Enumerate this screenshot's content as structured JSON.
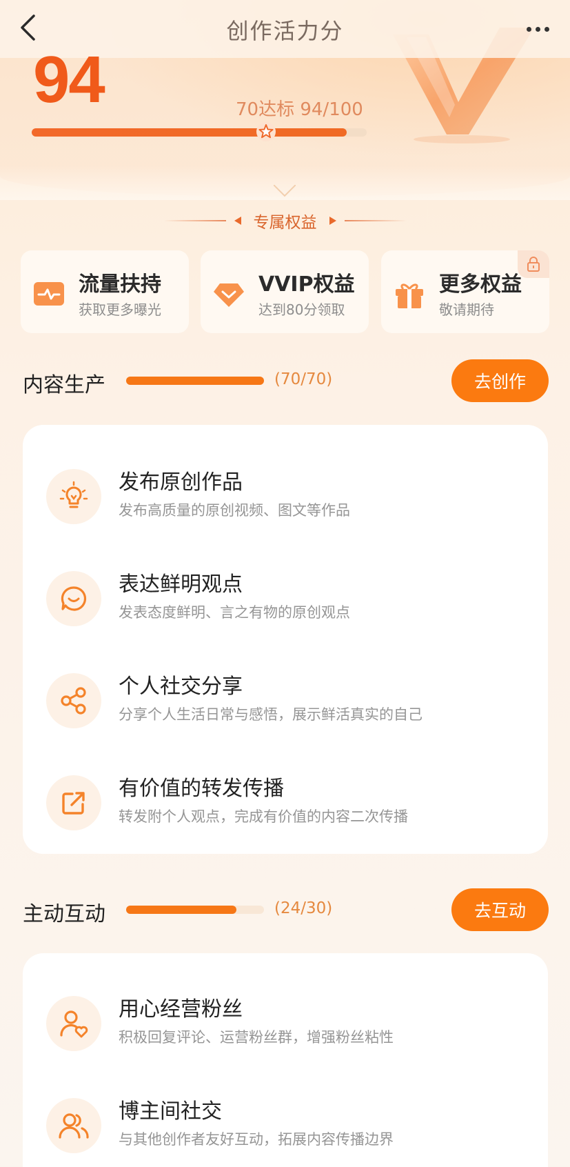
{
  "header": {
    "title": "创作活力分",
    "score": "94",
    "threshold_text": "70达标 94/100",
    "progress_fraction": 0.94,
    "marker_fraction": 0.7
  },
  "rights": {
    "heading": "专属权益",
    "items": [
      {
        "icon": "traffic-support-icon",
        "title": "流量扶持",
        "subtitle": "获取更多曝光"
      },
      {
        "icon": "diamond-icon",
        "title": "VVIP权益",
        "subtitle": "达到80分领取"
      },
      {
        "icon": "gift-icon",
        "title": "更多权益",
        "subtitle": "敬请期待",
        "locked": true
      }
    ]
  },
  "sections": [
    {
      "title": "内容生产",
      "count_text": "(70/70)",
      "progress_fraction": 1.0,
      "button_label": "去创作",
      "tasks": [
        {
          "icon": "lightbulb-icon",
          "title": "发布原创作品",
          "desc": "发布高质量的原创视频、图文等作品"
        },
        {
          "icon": "chat-bubble-icon",
          "title": "表达鲜明观点",
          "desc": "发表态度鲜明、言之有物的原创观点"
        },
        {
          "icon": "share-icon",
          "title": "个人社交分享",
          "desc": "分享个人生活日常与感悟，展示鲜活真实的自己"
        },
        {
          "icon": "forward-icon",
          "title": "有价值的转发传播",
          "desc": "转发附个人观点，完成有价值的内容二次传播"
        }
      ]
    },
    {
      "title": "主动互动",
      "count_text": "(24/30)",
      "progress_fraction": 0.8,
      "button_label": "去互动",
      "tasks": [
        {
          "icon": "fan-heart-icon",
          "title": "用心经营粉丝",
          "desc": "积极回复评论、运营粉丝群，增强粉丝粘性"
        },
        {
          "icon": "users-icon",
          "title": "博主间社交",
          "desc": "与其他创作者友好互动，拓展内容传播边界"
        }
      ]
    }
  ],
  "colors": {
    "accent": "#fb7a10",
    "score": "#f05a1a",
    "icon": "#f4832a"
  }
}
